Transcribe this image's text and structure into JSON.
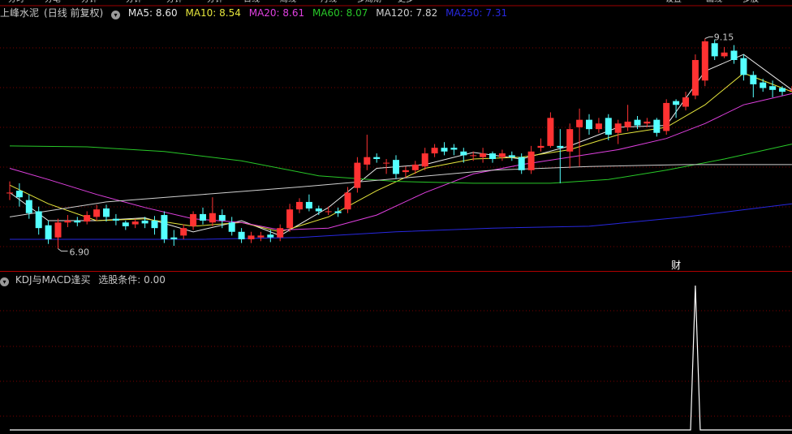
{
  "toolbar": {
    "items": [
      "分时",
      "分笔",
      "分钟",
      "分钟",
      "分钟",
      "分钟",
      "日线",
      "周线",
      "月线",
      "多周期",
      "更多",
      "设置",
      "画线",
      "多股"
    ]
  },
  "main_chart": {
    "stock_name": "上峰水泥",
    "period": "(日线 前复权)",
    "ma": [
      {
        "label": "MA5: 8.60",
        "color": "#e8e8e8"
      },
      {
        "label": "MA10: 8.54",
        "color": "#e6e63c"
      },
      {
        "label": "MA20: 8.61",
        "color": "#e040e0"
      },
      {
        "label": "MA60: 8.07",
        "color": "#28c828"
      },
      {
        "label": "MA120: 7.82",
        "color": "#d0d0d0"
      },
      {
        "label": "MA250: 7.31",
        "color": "#2828e0"
      }
    ],
    "high_marker": "9.15",
    "low_marker": "6.90",
    "event_marker": "财"
  },
  "indicator_panel": {
    "name": "KDJ与MACD逢买",
    "condition": "选股条件: 0.00"
  },
  "chart_data": {
    "type": "candlestick",
    "ylim": [
      6.8,
      9.25
    ],
    "candles": [
      [
        7.5,
        7.5,
        7.62,
        7.42
      ],
      [
        7.52,
        7.45,
        7.6,
        7.35
      ],
      [
        7.42,
        7.28,
        7.48,
        7.22
      ],
      [
        7.3,
        7.12,
        7.35,
        7.05
      ],
      [
        7.15,
        7.0,
        7.2,
        6.95
      ],
      [
        7.02,
        7.18,
        7.22,
        6.9
      ],
      [
        7.18,
        7.2,
        7.26,
        7.13
      ],
      [
        7.2,
        7.18,
        7.24,
        7.14
      ],
      [
        7.19,
        7.26,
        7.3,
        7.16
      ],
      [
        7.24,
        7.32,
        7.37,
        7.2
      ],
      [
        7.33,
        7.24,
        7.37,
        7.19
      ],
      [
        7.22,
        7.2,
        7.27,
        7.15
      ],
      [
        7.18,
        7.14,
        7.2,
        7.1
      ],
      [
        7.16,
        7.19,
        7.22,
        7.12
      ],
      [
        7.2,
        7.17,
        7.24,
        7.12
      ],
      [
        7.2,
        7.12,
        7.25,
        7.05
      ],
      [
        7.26,
        7.0,
        7.3,
        6.96
      ],
      [
        7.02,
        7.0,
        7.1,
        6.93
      ],
      [
        7.04,
        7.12,
        7.16,
        7.0
      ],
      [
        7.14,
        7.27,
        7.3,
        7.1
      ],
      [
        7.27,
        7.2,
        7.34,
        7.16
      ],
      [
        7.18,
        7.28,
        7.45,
        7.14
      ],
      [
        7.26,
        7.2,
        7.32,
        7.12
      ],
      [
        7.18,
        7.08,
        7.24,
        7.04
      ],
      [
        7.08,
        7.0,
        7.12,
        6.96
      ],
      [
        7.0,
        7.04,
        7.08,
        6.96
      ],
      [
        7.02,
        7.04,
        7.08,
        6.98
      ],
      [
        7.05,
        7.02,
        7.1,
        6.97
      ],
      [
        7.02,
        7.12,
        7.16,
        6.98
      ],
      [
        7.12,
        7.32,
        7.38,
        7.08
      ],
      [
        7.32,
        7.4,
        7.44,
        7.28
      ],
      [
        7.4,
        7.33,
        7.48,
        7.3
      ],
      [
        7.33,
        7.3,
        7.36,
        7.26
      ],
      [
        7.3,
        7.3,
        7.35,
        7.26
      ],
      [
        7.3,
        7.28,
        7.34,
        7.24
      ],
      [
        7.32,
        7.5,
        7.56,
        7.28
      ],
      [
        7.55,
        7.82,
        7.88,
        7.5
      ],
      [
        7.8,
        7.88,
        8.12,
        7.74
      ],
      [
        7.88,
        7.86,
        7.92,
        7.82
      ],
      [
        7.82,
        7.82,
        7.86,
        7.7
      ],
      [
        7.85,
        7.7,
        7.9,
        7.65
      ],
      [
        7.72,
        7.74,
        7.78,
        7.66
      ],
      [
        7.74,
        7.8,
        7.84,
        7.7
      ],
      [
        7.78,
        7.92,
        7.98,
        7.74
      ],
      [
        7.92,
        7.98,
        8.02,
        7.88
      ],
      [
        7.98,
        7.94,
        8.04,
        7.9
      ],
      [
        7.98,
        7.96,
        8.02,
        7.9
      ],
      [
        7.94,
        7.9,
        7.98,
        7.82
      ],
      [
        7.9,
        7.9,
        7.94,
        7.84
      ],
      [
        7.88,
        7.92,
        7.98,
        7.82
      ],
      [
        7.92,
        7.86,
        7.94,
        7.82
      ],
      [
        7.88,
        7.92,
        7.96,
        7.84
      ],
      [
        7.9,
        7.88,
        7.94,
        7.84
      ],
      [
        7.88,
        7.74,
        7.92,
        7.7
      ],
      [
        7.74,
        7.94,
        8.0,
        7.7
      ],
      [
        7.98,
        8.0,
        8.08,
        7.94
      ],
      [
        8.0,
        8.3,
        8.36,
        7.98
      ],
      [
        8.0,
        7.98,
        8.18,
        7.6
      ],
      [
        7.94,
        8.18,
        8.24,
        7.76
      ],
      [
        8.2,
        8.28,
        8.4,
        7.78
      ],
      [
        8.28,
        8.18,
        8.34,
        8.12
      ],
      [
        8.18,
        8.24,
        8.3,
        8.14
      ],
      [
        8.3,
        8.12,
        8.34,
        8.06
      ],
      [
        8.14,
        8.24,
        8.28,
        8.02
      ],
      [
        8.2,
        8.26,
        8.44,
        8.16
      ],
      [
        8.28,
        8.22,
        8.32,
        8.18
      ],
      [
        8.24,
        8.26,
        8.3,
        8.2
      ],
      [
        8.28,
        8.14,
        8.3,
        8.1
      ],
      [
        8.16,
        8.46,
        8.5,
        8.12
      ],
      [
        8.48,
        8.44,
        8.5,
        8.3
      ],
      [
        8.42,
        8.52,
        8.58,
        8.38
      ],
      [
        8.54,
        8.92,
        8.98,
        8.5
      ],
      [
        8.7,
        9.12,
        9.15,
        8.64
      ],
      [
        9.1,
        8.96,
        9.14,
        8.92
      ],
      [
        8.96,
        9.0,
        9.06,
        8.94
      ],
      [
        9.02,
        8.92,
        9.08,
        8.88
      ],
      [
        8.94,
        8.76,
        8.98,
        8.7
      ],
      [
        8.76,
        8.66,
        8.8,
        8.52
      ],
      [
        8.68,
        8.62,
        8.72,
        8.58
      ],
      [
        8.64,
        8.6,
        8.7,
        8.52
      ],
      [
        8.62,
        8.58,
        8.64,
        8.54
      ],
      [
        8.6,
        8.6,
        8.64,
        8.58
      ]
    ],
    "ma_lines": [
      {
        "name": "MA5",
        "color": "#e8e8e8",
        "points": [
          [
            0,
            7.5
          ],
          [
            4,
            7.2
          ],
          [
            9,
            7.2
          ],
          [
            14,
            7.23
          ],
          [
            19,
            7.08
          ],
          [
            24,
            7.2
          ],
          [
            28,
            7.04
          ],
          [
            33,
            7.34
          ],
          [
            38,
            7.76
          ],
          [
            43,
            7.8
          ],
          [
            48,
            7.93
          ],
          [
            53,
            7.86
          ],
          [
            58,
            8.0
          ],
          [
            63,
            8.2
          ],
          [
            68,
            8.22
          ],
          [
            72,
            8.8
          ],
          [
            76,
            8.98
          ],
          [
            81,
            8.6
          ]
        ]
      },
      {
        "name": "MA10",
        "color": "#e6e63c",
        "points": [
          [
            0,
            7.58
          ],
          [
            4,
            7.38
          ],
          [
            9,
            7.2
          ],
          [
            14,
            7.22
          ],
          [
            19,
            7.14
          ],
          [
            24,
            7.18
          ],
          [
            28,
            7.08
          ],
          [
            33,
            7.24
          ],
          [
            38,
            7.52
          ],
          [
            43,
            7.76
          ],
          [
            48,
            7.86
          ],
          [
            53,
            7.88
          ],
          [
            58,
            7.96
          ],
          [
            63,
            8.12
          ],
          [
            68,
            8.2
          ],
          [
            72,
            8.44
          ],
          [
            76,
            8.78
          ],
          [
            81,
            8.58
          ]
        ]
      },
      {
        "name": "MA20",
        "color": "#e040e0",
        "points": [
          [
            0,
            7.76
          ],
          [
            4,
            7.64
          ],
          [
            9,
            7.48
          ],
          [
            14,
            7.34
          ],
          [
            19,
            7.22
          ],
          [
            24,
            7.18
          ],
          [
            28,
            7.1
          ],
          [
            33,
            7.12
          ],
          [
            38,
            7.26
          ],
          [
            43,
            7.5
          ],
          [
            48,
            7.7
          ],
          [
            53,
            7.8
          ],
          [
            58,
            7.88
          ],
          [
            63,
            7.96
          ],
          [
            68,
            8.08
          ],
          [
            72,
            8.24
          ],
          [
            76,
            8.44
          ],
          [
            81,
            8.56
          ]
        ]
      },
      {
        "name": "MA60",
        "color": "#28c828",
        "points": [
          [
            0,
            8.0
          ],
          [
            8,
            7.99
          ],
          [
            16,
            7.94
          ],
          [
            24,
            7.84
          ],
          [
            32,
            7.68
          ],
          [
            40,
            7.62
          ],
          [
            48,
            7.6
          ],
          [
            56,
            7.6
          ],
          [
            62,
            7.64
          ],
          [
            68,
            7.74
          ],
          [
            74,
            7.86
          ],
          [
            81,
            8.02
          ]
        ]
      },
      {
        "name": "MA120",
        "color": "#d0d0d0",
        "points": [
          [
            0,
            7.24
          ],
          [
            10,
            7.4
          ],
          [
            20,
            7.48
          ],
          [
            30,
            7.56
          ],
          [
            40,
            7.65
          ],
          [
            50,
            7.74
          ],
          [
            60,
            7.78
          ],
          [
            70,
            7.8
          ],
          [
            81,
            7.8
          ]
        ]
      },
      {
        "name": "MA250",
        "color": "#2828e0",
        "points": [
          [
            0,
            7.0
          ],
          [
            20,
            7.0
          ],
          [
            30,
            7.02
          ],
          [
            40,
            7.08
          ],
          [
            50,
            7.12
          ],
          [
            60,
            7.14
          ],
          [
            70,
            7.24
          ],
          [
            81,
            7.38
          ]
        ]
      }
    ],
    "indicator": {
      "ylim": [
        0,
        1
      ],
      "values": [
        [
          0,
          0
        ],
        [
          70.5,
          0
        ],
        [
          71,
          1
        ],
        [
          71.5,
          0
        ],
        [
          81,
          0
        ]
      ]
    }
  }
}
